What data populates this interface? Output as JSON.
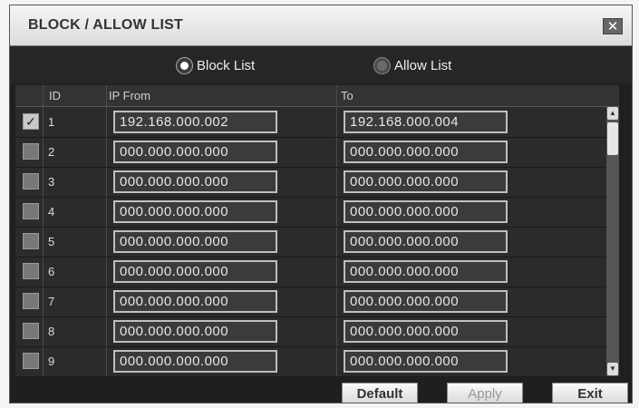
{
  "dialog": {
    "title": "BLOCK / ALLOW LIST",
    "close_label": "✕"
  },
  "mode": {
    "options": [
      {
        "label": "Block List",
        "selected": true
      },
      {
        "label": "Allow List",
        "selected": false
      }
    ]
  },
  "table": {
    "columns": {
      "id": "ID",
      "from": "IP From",
      "to": "To"
    },
    "rows": [
      {
        "id": "1",
        "checked": true,
        "from": "192.168.000.002",
        "to": "192.168.000.004"
      },
      {
        "id": "2",
        "checked": false,
        "from": "000.000.000.000",
        "to": "000.000.000.000"
      },
      {
        "id": "3",
        "checked": false,
        "from": "000.000.000.000",
        "to": "000.000.000.000"
      },
      {
        "id": "4",
        "checked": false,
        "from": "000.000.000.000",
        "to": "000.000.000.000"
      },
      {
        "id": "5",
        "checked": false,
        "from": "000.000.000.000",
        "to": "000.000.000.000"
      },
      {
        "id": "6",
        "checked": false,
        "from": "000.000.000.000",
        "to": "000.000.000.000"
      },
      {
        "id": "7",
        "checked": false,
        "from": "000.000.000.000",
        "to": "000.000.000.000"
      },
      {
        "id": "8",
        "checked": false,
        "from": "000.000.000.000",
        "to": "000.000.000.000"
      },
      {
        "id": "9",
        "checked": false,
        "from": "000.000.000.000",
        "to": "000.000.000.000"
      }
    ]
  },
  "footer": {
    "default_label": "Default",
    "apply_label": "Apply",
    "exit_label": "Exit"
  }
}
